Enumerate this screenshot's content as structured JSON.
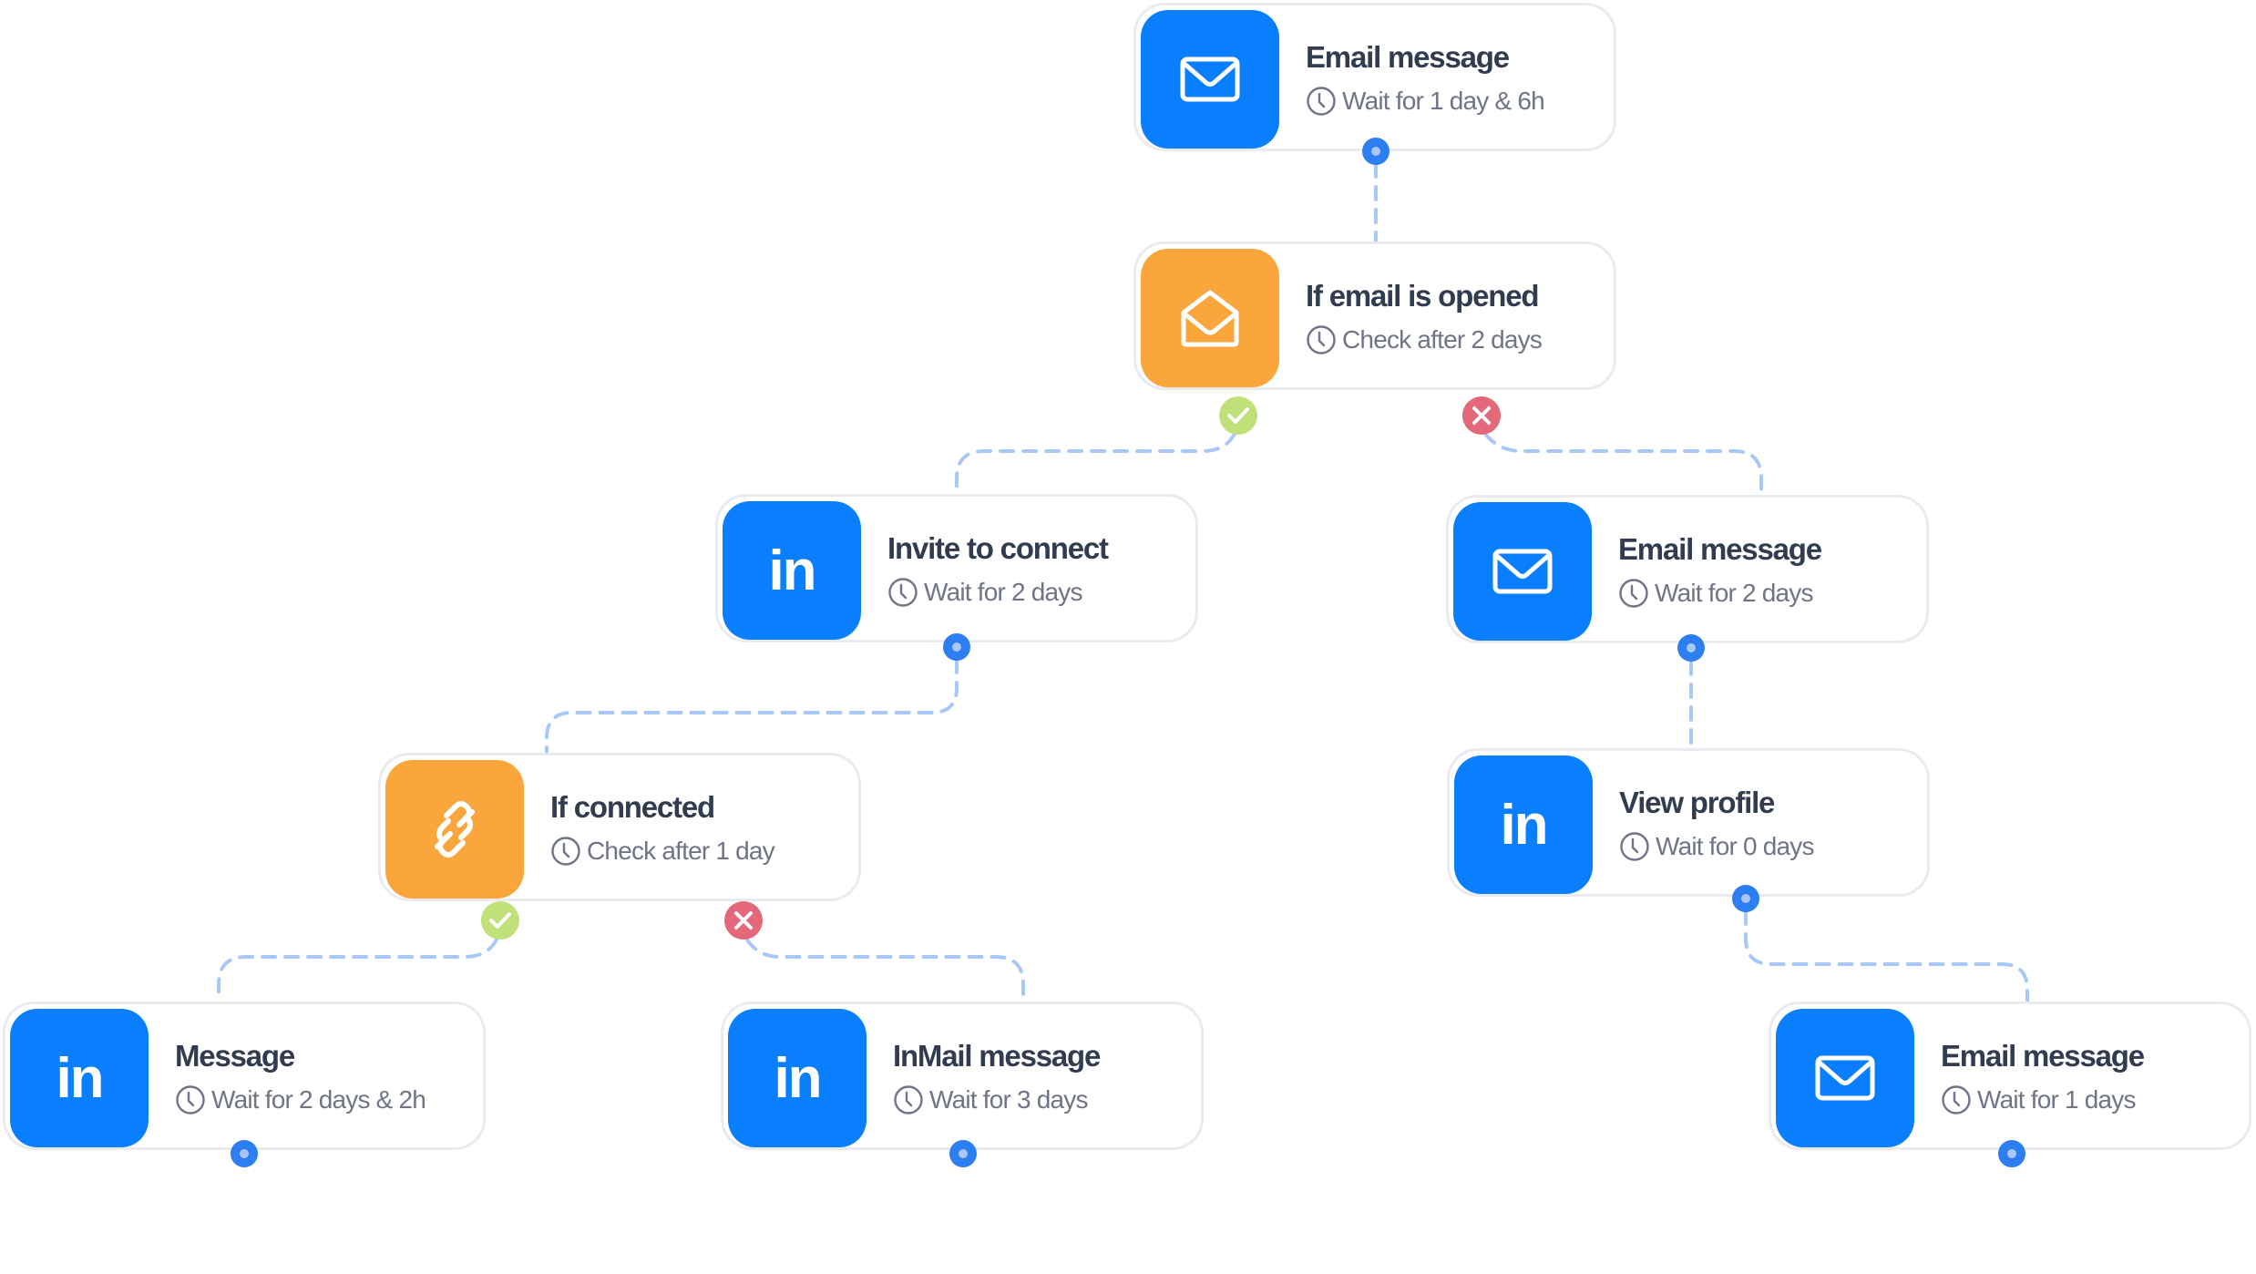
{
  "colors": {
    "action_blue": "#0a7ffd",
    "condition_orange": "#fba63c",
    "port_blue": "#2d7ef0",
    "yes_green": "#c0e07a",
    "no_red": "#e2687a",
    "connector": "#a9c8f7",
    "title_text": "#323c50",
    "sub_text": "#6f7587"
  },
  "nodes": [
    {
      "id": "email-1",
      "icon": "envelope-icon",
      "kind": "action",
      "title": "Email message",
      "subtitle": "Wait for 1 day & 6h"
    },
    {
      "id": "if-opened",
      "icon": "envelope-open-icon",
      "kind": "condition",
      "title": "If email is opened",
      "subtitle": "Check after 2 days"
    },
    {
      "id": "invite",
      "icon": "linkedin-icon",
      "kind": "action",
      "title": "Invite to connect",
      "subtitle": "Wait for 2 days"
    },
    {
      "id": "email-2",
      "icon": "envelope-icon",
      "kind": "action",
      "title": "Email message",
      "subtitle": "Wait for 2 days"
    },
    {
      "id": "if-connected",
      "icon": "link-icon",
      "kind": "condition",
      "title": "If connected",
      "subtitle": "Check after 1 day"
    },
    {
      "id": "view-profile",
      "icon": "linkedin-icon",
      "kind": "action",
      "title": "View profile",
      "subtitle": "Wait for 0 days"
    },
    {
      "id": "message",
      "icon": "linkedin-icon",
      "kind": "action",
      "title": "Message",
      "subtitle": "Wait for 2 days & 2h"
    },
    {
      "id": "inmail",
      "icon": "linkedin-icon",
      "kind": "action",
      "title": "InMail message",
      "subtitle": "Wait for 3 days"
    },
    {
      "id": "email-3",
      "icon": "envelope-icon",
      "kind": "action",
      "title": "Email message",
      "subtitle": "Wait for 1 days"
    }
  ],
  "linkedin_glyph": "in",
  "edges": [
    {
      "from": "email-1",
      "to": "if-opened",
      "branch": "next"
    },
    {
      "from": "if-opened",
      "to": "invite",
      "branch": "yes"
    },
    {
      "from": "if-opened",
      "to": "email-2",
      "branch": "no"
    },
    {
      "from": "invite",
      "to": "if-connected",
      "branch": "next"
    },
    {
      "from": "email-2",
      "to": "view-profile",
      "branch": "next"
    },
    {
      "from": "if-connected",
      "to": "message",
      "branch": "yes"
    },
    {
      "from": "if-connected",
      "to": "inmail",
      "branch": "no"
    },
    {
      "from": "view-profile",
      "to": "email-3",
      "branch": "next"
    }
  ]
}
